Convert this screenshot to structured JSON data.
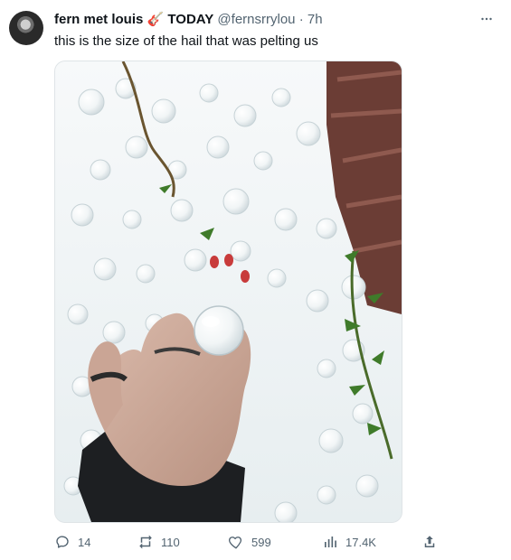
{
  "tweet": {
    "display_name": "fern met louis",
    "name_emoji": "🎸",
    "name_suffix": "TODAY",
    "handle": "@fernsrrylou",
    "separator": "·",
    "time": "7h",
    "text": "this is the size of the hail that was pelting us",
    "more_icon": "more-icon"
  },
  "actions": {
    "reply_count": "14",
    "retweet_count": "110",
    "like_count": "599",
    "views_count": "17.4K"
  },
  "colors": {
    "text": "#0f1419",
    "muted": "#536471",
    "media_bg": "#e9eef0"
  },
  "icons": {
    "reply": "reply-icon",
    "retweet": "retweet-icon",
    "like": "like-icon",
    "views": "views-icon",
    "share": "share-icon"
  }
}
